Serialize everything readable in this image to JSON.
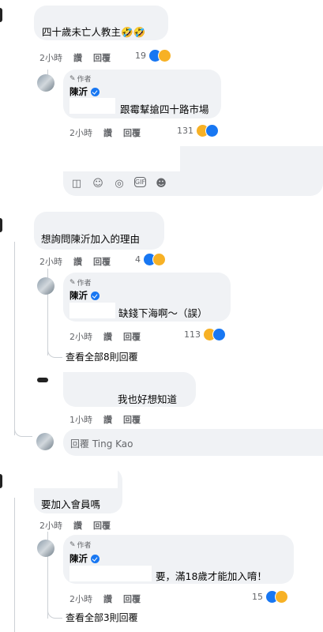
{
  "comments": [
    {
      "text": "四十歲未亡人教主🤣🤣",
      "time": "2小時",
      "like": "讚",
      "reply": "回覆",
      "reactions": "19"
    },
    {
      "author_tag": "作者",
      "name": "陳沂",
      "text": "跟霉鞤搶四十路市場",
      "time": "2小時",
      "like": "讚",
      "reply": "回覆",
      "reactions": "131"
    },
    {
      "text": "想詢問陳沂加入的理由",
      "time": "2小時",
      "like": "讚",
      "reply": "回覆",
      "reactions": "4"
    },
    {
      "author_tag": "作者",
      "name": "陳沂",
      "text": "缺錢下海啊～（誤）",
      "time": "2小時",
      "like": "讚",
      "reply": "回覆",
      "reactions": "113"
    },
    {
      "view_all": "查看全部8則回覆"
    },
    {
      "text": "我也好想知道",
      "time": "1小時",
      "like": "讚",
      "reply": "回覆"
    },
    {
      "reply_placeholder": "回覆 Ting Kao"
    },
    {
      "text": "要加入會員嗎",
      "time": "2小時",
      "like": "讚",
      "reply": "回覆"
    },
    {
      "author_tag": "作者",
      "name": "陳沂",
      "text": "要，滿18歲才能加入唷！",
      "time": "2小時",
      "like": "讚",
      "reply": "回覆",
      "reactions": "15"
    },
    {
      "view_all": "查看全部3則回覆"
    }
  ],
  "composer_tools": [
    "sticker-icon",
    "emoji-icon",
    "camera-icon",
    "gif-icon",
    "avatar-sticker-icon"
  ],
  "colors": {
    "bubble": "#f0f2f5",
    "meta": "#65676b",
    "like": "#1877f2",
    "haha": "#f7b125"
  }
}
